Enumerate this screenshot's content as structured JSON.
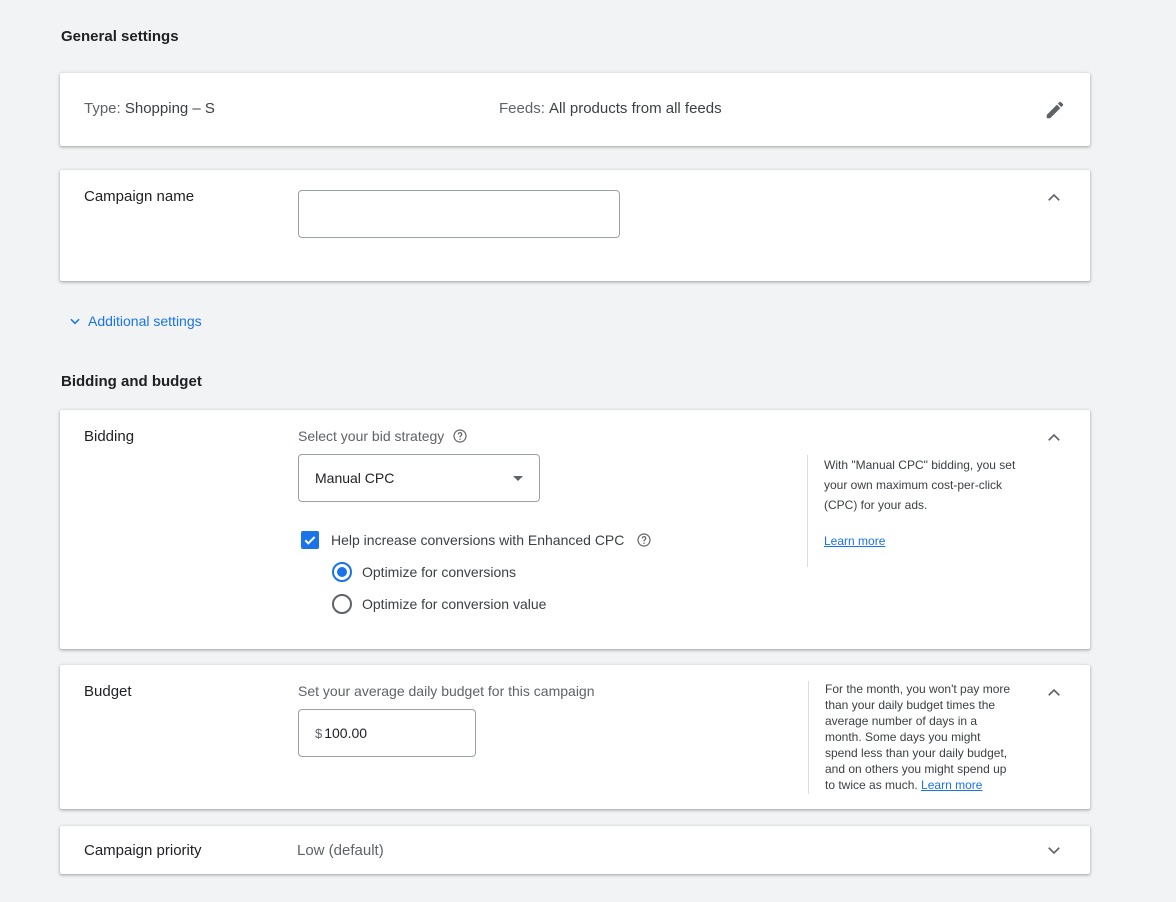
{
  "general": {
    "section_title": "General settings",
    "type_label": "Type: ",
    "type_value": "Shopping – S",
    "feeds_label": "Feeds: ",
    "feeds_value": "All products from all feeds"
  },
  "campaign_name": {
    "label": "Campaign name",
    "value": ""
  },
  "additional_settings": {
    "label": "Additional settings"
  },
  "bidding_budget": {
    "section_title": "Bidding and budget"
  },
  "bidding": {
    "label": "Bidding",
    "strategy_label": "Select your bid strategy",
    "strategy_value": "Manual CPC",
    "enhanced_label": "Help increase conversions with Enhanced CPC",
    "options": [
      {
        "label": "Optimize for conversions",
        "selected": true
      },
      {
        "label": "Optimize for conversion value",
        "selected": false
      }
    ],
    "info_line1": "With \"Manual CPC\" bidding, you set",
    "info_line2": "your own maximum cost-per-click",
    "info_line3": "(CPC) for your ads.",
    "learn_more": "Learn more"
  },
  "budget": {
    "label": "Budget",
    "prompt": "Set your average daily budget for this campaign",
    "currency": "$",
    "value": "100.00",
    "info_lines": [
      "For the month, you won't pay more",
      "than your daily budget times the",
      "average number of days in a",
      "month. Some days you might",
      "spend less than your daily budget,",
      "and on others you might spend up",
      "to twice as much."
    ],
    "learn_more": "Learn more"
  },
  "priority": {
    "label": "Campaign priority",
    "value": "Low (default)"
  },
  "colors": {
    "accent": "#1a73e8",
    "background": "#f1f3f4",
    "card": "#ffffff"
  }
}
